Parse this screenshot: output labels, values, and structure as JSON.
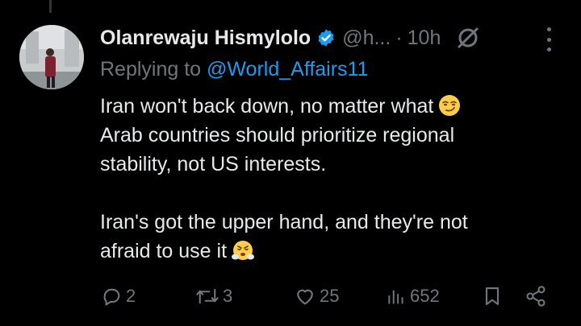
{
  "tweet": {
    "author_name": "Olanrewaju Hismylolo",
    "handle": "@h...",
    "separator": "·",
    "time": "10h",
    "replying_prefix": "Replying to",
    "replying_to": "@World_Affairs11",
    "lines": [
      "Iran won't back down, no matter what",
      "Arab countries should prioritize regional",
      "stability, not US interests.",
      "",
      "Iran's got the upper hand, and they're not",
      "afraid to use it"
    ],
    "emojis": [
      "smirking-face",
      "face-with-steam-from-nose"
    ]
  },
  "actions": {
    "replies": "2",
    "reposts": "3",
    "likes": "25",
    "views": "652"
  },
  "colors": {
    "background": "#000000",
    "text": "#e7e9ea",
    "muted": "#71767b",
    "accent": "#1d9bf0"
  }
}
